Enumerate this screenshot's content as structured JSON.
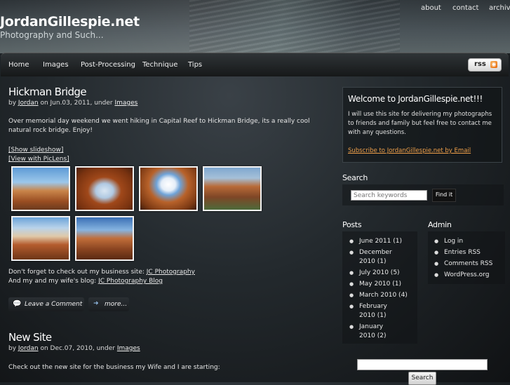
{
  "site": {
    "title": "JordanGillespie.net",
    "tagline": "Photography and Such..."
  },
  "top_links": [
    "about",
    "contact",
    "archive"
  ],
  "nav": {
    "items": [
      "Home",
      "Images",
      "Post-Processing",
      "Technique",
      "Tips"
    ],
    "rss_label": "rss"
  },
  "posts": [
    {
      "title": "Hickman Bridge",
      "meta_by": "by",
      "author": "Jordan",
      "meta_on": "on Jun.03, 2011, under",
      "category": "Images",
      "body": "Over memorial day weekend we went hiking in Capital Reef to Hickman Bridge, its a really cool natural rock bridge. Enjoy!",
      "show_slideshow": "[Show slideshow]",
      "view_piclens": "[View with PicLens]",
      "thumb_count": 6,
      "promo1_text": "Don't forget to check out my business site:",
      "promo1_link": "JC Photography",
      "promo2_text": "And my and my wife's blog:",
      "promo2_link": "JC Photography Blog",
      "comment_label": "Leave a Comment",
      "more_label": "more..."
    },
    {
      "title": "New Site",
      "meta_by": "by",
      "author": "Jordan",
      "meta_on": "on Dec.07, 2010, under",
      "category": "Images",
      "body": "Check out the new site for the business my Wife and I are starting:"
    }
  ],
  "sidebar": {
    "welcome": {
      "title": "Welcome to JordanGillespie.net!!!",
      "text": "I will use this site for delivering my photographs to friends and family but feel free to contact me with any questions.",
      "subscribe_link": "Subscribe to JordanGillespie.net by Email"
    },
    "search": {
      "title": "Search",
      "placeholder": "Search keywords",
      "button": "Find it"
    },
    "posts": {
      "title": "Posts",
      "items": [
        [
          "June 2011 (1)"
        ],
        [
          "December",
          "2010 (1)"
        ],
        [
          "July 2010 (5)"
        ],
        [
          "May 2010 (1)"
        ],
        [
          "March 2010 (4)"
        ],
        [
          "February",
          "2010 (1)"
        ],
        [
          "January",
          "2010 (2)"
        ]
      ]
    },
    "admin": {
      "title": "Admin",
      "items": [
        "Log in",
        "Entries RSS",
        "Comments RSS",
        "WordPress.org"
      ]
    },
    "bottom_search": {
      "button": "Search"
    }
  }
}
